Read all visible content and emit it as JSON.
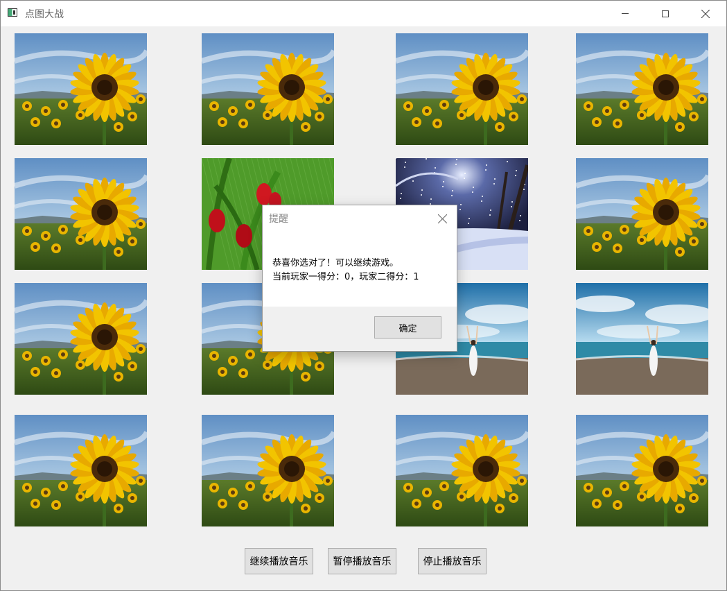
{
  "window": {
    "title": "点图大战",
    "icon": "app-window-icon"
  },
  "grid": {
    "tiles": [
      {
        "image": "sunflower"
      },
      {
        "image": "sunflower"
      },
      {
        "image": "sunflower"
      },
      {
        "image": "sunflower"
      },
      {
        "image": "sunflower"
      },
      {
        "image": "red-tulips"
      },
      {
        "image": "snowy-night"
      },
      {
        "image": "sunflower"
      },
      {
        "image": "sunflower"
      },
      {
        "image": "sunflower"
      },
      {
        "image": "beach-girl"
      },
      {
        "image": "beach-girl"
      },
      {
        "image": "sunflower"
      },
      {
        "image": "sunflower"
      },
      {
        "image": "sunflower"
      },
      {
        "image": "sunflower"
      }
    ]
  },
  "buttons": {
    "resume_music": "继续播放音乐",
    "pause_music": "暂停播放音乐",
    "stop_music": "停止播放音乐"
  },
  "dialog": {
    "title": "提醒",
    "line1": "恭喜你选对了！可以继续游戏。",
    "line2": "当前玩家一得分：0，玩家二得分：1",
    "ok_label": "确定"
  },
  "colors": {
    "window_bg": "#f0f0f0",
    "button_bg": "#e1e1e1",
    "button_border": "#adadad"
  }
}
